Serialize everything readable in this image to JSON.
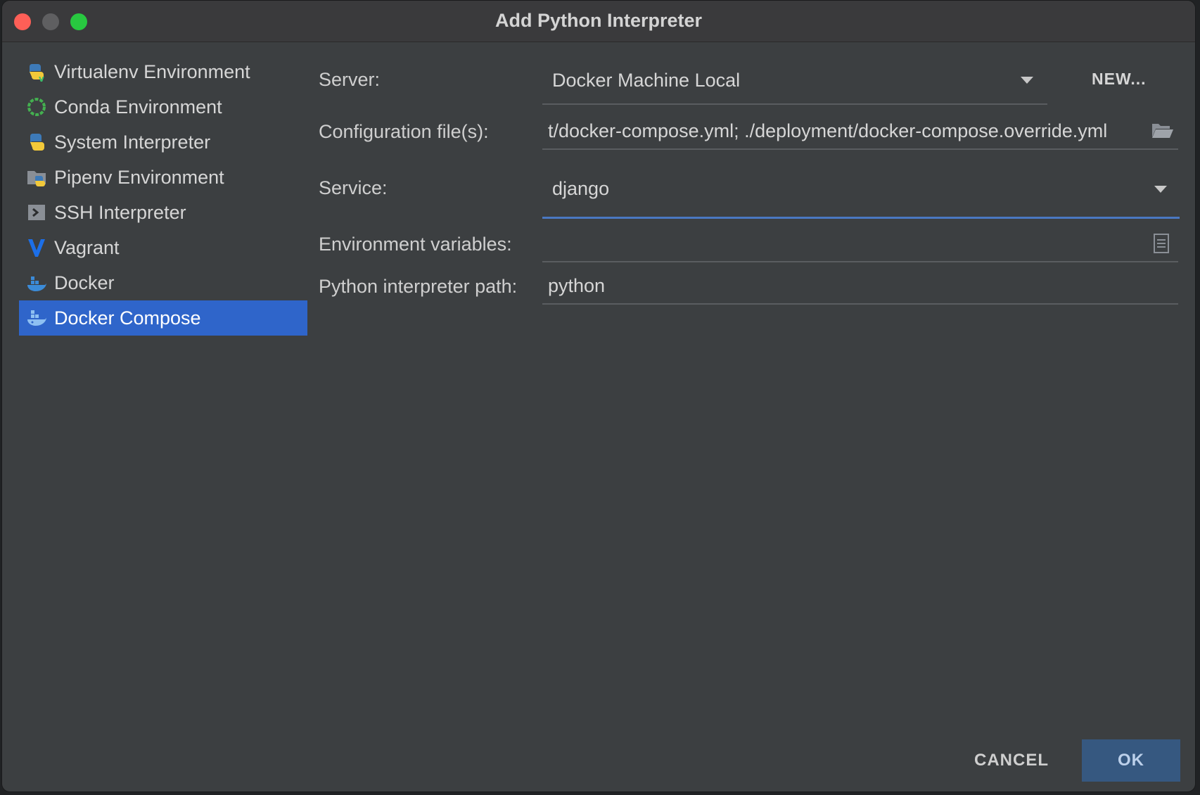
{
  "window": {
    "title": "Add Python Interpreter"
  },
  "sidebar": {
    "items": [
      {
        "label": "Virtualenv Environment",
        "icon": "python-virtualenv-icon"
      },
      {
        "label": "Conda Environment",
        "icon": "conda-icon"
      },
      {
        "label": "System Interpreter",
        "icon": "python-icon"
      },
      {
        "label": "Pipenv Environment",
        "icon": "pipenv-icon"
      },
      {
        "label": "SSH Interpreter",
        "icon": "ssh-terminal-icon"
      },
      {
        "label": "Vagrant",
        "icon": "vagrant-icon"
      },
      {
        "label": "Docker",
        "icon": "docker-icon"
      },
      {
        "label": "Docker Compose",
        "icon": "docker-compose-icon",
        "selected": true
      }
    ]
  },
  "form": {
    "server": {
      "label": "Server:",
      "value": "Docker Machine Local",
      "new_label": "NEW..."
    },
    "config": {
      "label": "Configuration file(s):",
      "value": "t/docker-compose.yml; ./deployment/docker-compose.override.yml"
    },
    "service": {
      "label": "Service:",
      "value": "django"
    },
    "env": {
      "label": "Environment variables:",
      "value": ""
    },
    "python_path": {
      "label": "Python interpreter path:",
      "value": "python"
    }
  },
  "buttons": {
    "cancel": "CANCEL",
    "ok": "OK"
  },
  "colors": {
    "accent": "#2f65ca",
    "ok_button": "#365880",
    "focus_underline": "#4a78c2"
  }
}
